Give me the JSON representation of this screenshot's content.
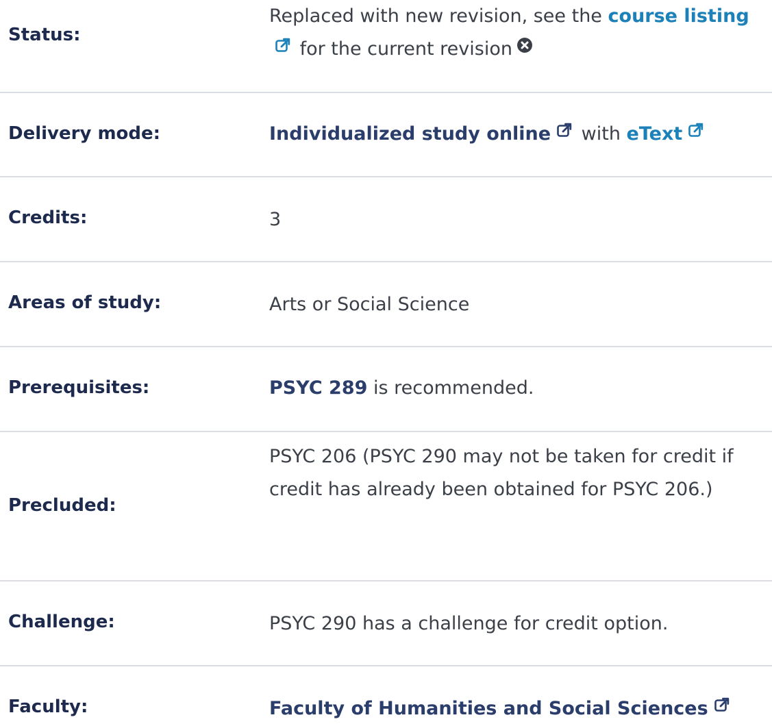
{
  "rows": [
    {
      "label": "Status:",
      "parts": [
        "Replaced with new revision, see the ",
        "course listing",
        " for the current revision"
      ]
    },
    {
      "label": "Delivery mode:",
      "parts": [
        "Individualized study online",
        " with ",
        "eText"
      ]
    },
    {
      "label": "Credits:",
      "value": "3"
    },
    {
      "label": "Areas of study:",
      "value": "Arts or Social Science"
    },
    {
      "label": "Prerequisites:",
      "parts": [
        "PSYC 289",
        " is recommended."
      ]
    },
    {
      "label": "Precluded:",
      "value": "PSYC 206 (PSYC 290 may not be taken for credit if credit has already been obtained for PSYC 206.)"
    },
    {
      "label": "Challenge:",
      "value": "PSYC 290 has a challenge for credit option."
    },
    {
      "label": "Faculty:",
      "parts": [
        "Faculty of Humanities and Social Sciences"
      ]
    }
  ],
  "colors": {
    "label": "#1d2a4e",
    "link": "#1b81b8",
    "link_dark": "#2a3d6b",
    "text": "#3b3f47",
    "divider": "#dadde3"
  },
  "icons": {
    "external_link": "external-link-icon",
    "close": "close-circle-icon"
  }
}
